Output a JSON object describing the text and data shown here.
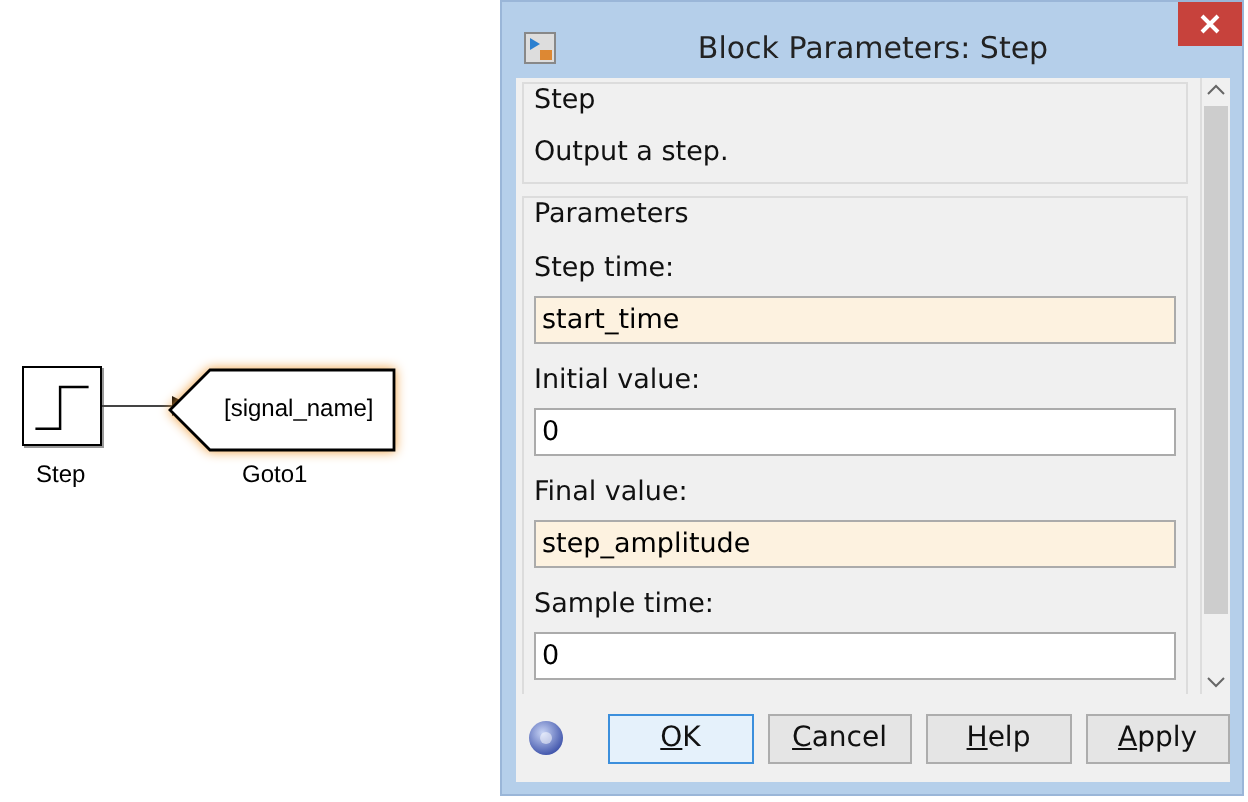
{
  "diagram": {
    "blocks": [
      {
        "kind": "step",
        "label": "Step"
      },
      {
        "kind": "goto",
        "tag": "[signal_name]",
        "label": "Goto1",
        "selected": true
      }
    ]
  },
  "dialog": {
    "title": "Block Parameters: Step",
    "description_group": {
      "title": "Step",
      "text": "Output a step."
    },
    "parameters_group": {
      "title": "Parameters",
      "fields": [
        {
          "label": "Step time:",
          "value": "start_time",
          "highlighted": true
        },
        {
          "label": "Initial value:",
          "value": "0",
          "highlighted": false
        },
        {
          "label": "Final value:",
          "value": "step_amplitude",
          "highlighted": true
        },
        {
          "label": "Sample time:",
          "value": "0",
          "highlighted": false
        }
      ]
    },
    "buttons": [
      {
        "label": "OK",
        "underline_first": true,
        "focused": true
      },
      {
        "label": "Cancel",
        "underline_first": true,
        "focused": false
      },
      {
        "label": "Help",
        "underline_first": true,
        "focused": false
      },
      {
        "label": "Apply",
        "underline_first": true,
        "focused": false
      }
    ]
  }
}
